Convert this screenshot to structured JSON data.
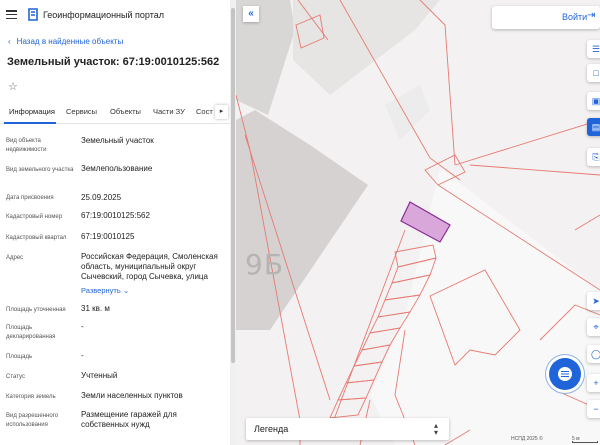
{
  "header": {
    "title": "Геоинформационный портал"
  },
  "back_link": "Назад в найденные объекты",
  "object_title": "Земельный участок: 67:19:0010125:562",
  "tabs": [
    "Информация",
    "Сервисы",
    "Объекты",
    "Части ЗУ",
    "Сост"
  ],
  "properties": [
    {
      "label": "Вид объекта недвижимости",
      "value": "Земельный участок"
    },
    {
      "label": "Вид земельного участка",
      "value": "Землепользование"
    },
    {
      "label": "Дата присвоения",
      "value": "25.09.2025"
    },
    {
      "label": "Кадастровый номер",
      "value": "67:19:0010125:562"
    },
    {
      "label": "Кадастровый квартал",
      "value": "67:19:0010125"
    },
    {
      "label": "Адрес",
      "value": "Российская Федерация, Смоленская область, муниципальный округ Сычевский, город Сычевка, улица"
    },
    {
      "label": "Площадь уточненная",
      "value": "31 кв. м"
    },
    {
      "label": "Площадь декларированная",
      "value": "-"
    },
    {
      "label": "Площадь",
      "value": "-"
    },
    {
      "label": "Статус",
      "value": "Учтенный"
    },
    {
      "label": "Категория земель",
      "value": "Земли населенных пунктов"
    },
    {
      "label": "Вид разрешенного использования",
      "value": "Размещение гаражей для собственных нужд"
    }
  ],
  "expand_link": "Развернуть",
  "map": {
    "login_label": "Войти",
    "legend_label": "Легенда",
    "building_label": "9Б",
    "attribution": "НСПД 2025 ©",
    "scale_label": "5 м"
  },
  "colors": {
    "accent": "#1f64d8",
    "parcel_line": "#e67a73",
    "selected_fill": "#d9a7d9",
    "selected_stroke": "#8a2b97"
  },
  "icons": [
    "menu-icon",
    "logo-icon",
    "star-icon",
    "login-icon",
    "chat-icon"
  ]
}
